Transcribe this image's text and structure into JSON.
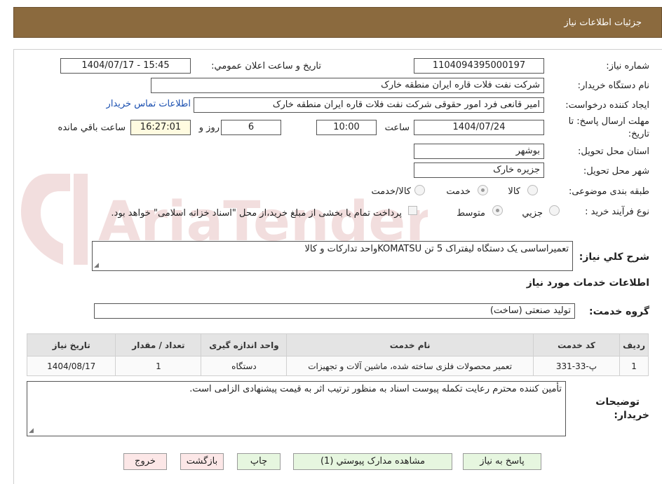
{
  "header": {
    "title": "جزئیات اطلاعات نیاز"
  },
  "form": {
    "need_number_label": "شماره نیاز:",
    "need_number": "1104094395000197",
    "announce_label": "تاریخ و ساعت اعلان عمومي:",
    "announce_value": "1404/07/17 - 15:45",
    "buyer_org_label": "نام دستگاه خریدار:",
    "buyer_org": "شرکت نفت فلات قاره ایران منطقه خارک",
    "requester_label": "ایجاد کننده درخواست:",
    "requester": "امیر قانعی فرد امور حقوقی شرکت نفت فلات قاره ایران منطقه خارک",
    "contact_link": "اطلاعات تماس خریدار",
    "deadline_label_1": "مهلت ارسال پاسخ: تا",
    "deadline_label_2": "تاریخ:",
    "deadline_date": "1404/07/24",
    "time_word": "ساعت",
    "deadline_time": "10:00",
    "days": "6",
    "days_word": "روز و",
    "remaining": "16:27:01",
    "remaining_word": "ساعت باقي مانده",
    "province_label": "استان محل تحویل:",
    "province": "بوشهر",
    "city_label": "شهر محل تحویل:",
    "city": "جزیره خارک",
    "category_label": "طبقه بندی موضوعی:",
    "category_options": [
      "کالا",
      "خدمت",
      "کالا/خدمت"
    ],
    "category_selected": "خدمت",
    "process_label": "نوع فرآیند خرید :",
    "process_options": [
      "جزيي",
      "متوسط"
    ],
    "process_selected": "متوسط",
    "payment_note": "پرداخت تمام یا بخشی از مبلغ خرید،از محل \"اسناد خزانه اسلامی\" خواهد بود.",
    "summary_label": "شرح کلي نیاز:",
    "summary": "تعمیراساسی یک دستگاه لیفتراک 5 تن KOMATSUواحد  تدارکات و کالا",
    "services_title": "اطلاعات خدمات مورد نیاز",
    "service_group_label": "گروه خدمت:",
    "service_group": "تولید صنعتی (ساخت)",
    "buyer_notes_label_1": "توضیحات",
    "buyer_notes_label_2": "خریدار:",
    "buyer_notes": "تأمین کننده محترم رعایت تکمله پیوست اسناد به منظور ترتیب اثر به قیمت پیشنهادی الزامی است."
  },
  "table": {
    "headers": [
      "ردیف",
      "کد خدمت",
      "نام خدمت",
      "واحد اندازه گیری",
      "تعداد / مقدار",
      "تاریخ نیاز"
    ],
    "rows": [
      [
        "1",
        "پ-33-331",
        "تعمیر محصولات فلزی ساخته شده، ماشین آلات و تجهیزات",
        "دستگاه",
        "1",
        "1404/08/17"
      ]
    ]
  },
  "buttons": {
    "reply": "پاسخ به نیاز",
    "attachments": "مشاهده مدارک پیوستي (1)",
    "print": "چاپ",
    "back": "بازگشت",
    "exit": "خروج"
  },
  "watermark": {
    "text": "AriaTender.neT",
    "color": "#b03a3a"
  }
}
